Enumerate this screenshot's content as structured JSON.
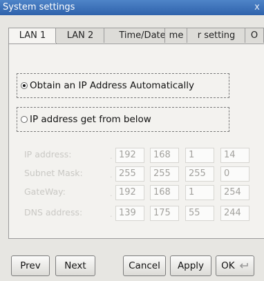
{
  "window": {
    "title": "System settings",
    "close_symbol": "x"
  },
  "tabs": [
    {
      "label": "LAN 1",
      "active": true
    },
    {
      "label": "LAN 2",
      "active": false
    },
    {
      "label": "Time/Date",
      "active": false
    },
    {
      "label": "me",
      "active": false
    },
    {
      "label": "r setting",
      "active": false
    },
    {
      "label": "O",
      "active": false
    }
  ],
  "options": {
    "auto": {
      "label": "Obtain an IP Address Automatically",
      "selected": true
    },
    "manual": {
      "label": "IP address get from below",
      "selected": false
    }
  },
  "fields": [
    {
      "label": "IP address:",
      "values": [
        "192",
        "168",
        "1",
        "14"
      ]
    },
    {
      "label": "Subnet Mask:",
      "values": [
        "255",
        "255",
        "255",
        "0"
      ]
    },
    {
      "label": "GateWay:",
      "values": [
        "192",
        "168",
        "1",
        "254"
      ]
    },
    {
      "label": "DNS address:",
      "values": [
        "139",
        "175",
        "55",
        "244"
      ]
    }
  ],
  "buttons": {
    "prev": "Prev",
    "next": "Next",
    "cancel": "Cancel",
    "apply": "Apply",
    "ok": "OK",
    "ok_icon": "enter-icon"
  },
  "colors": {
    "titlebar": "#3a6fb8",
    "disabled_text": "#c9c8c4"
  }
}
